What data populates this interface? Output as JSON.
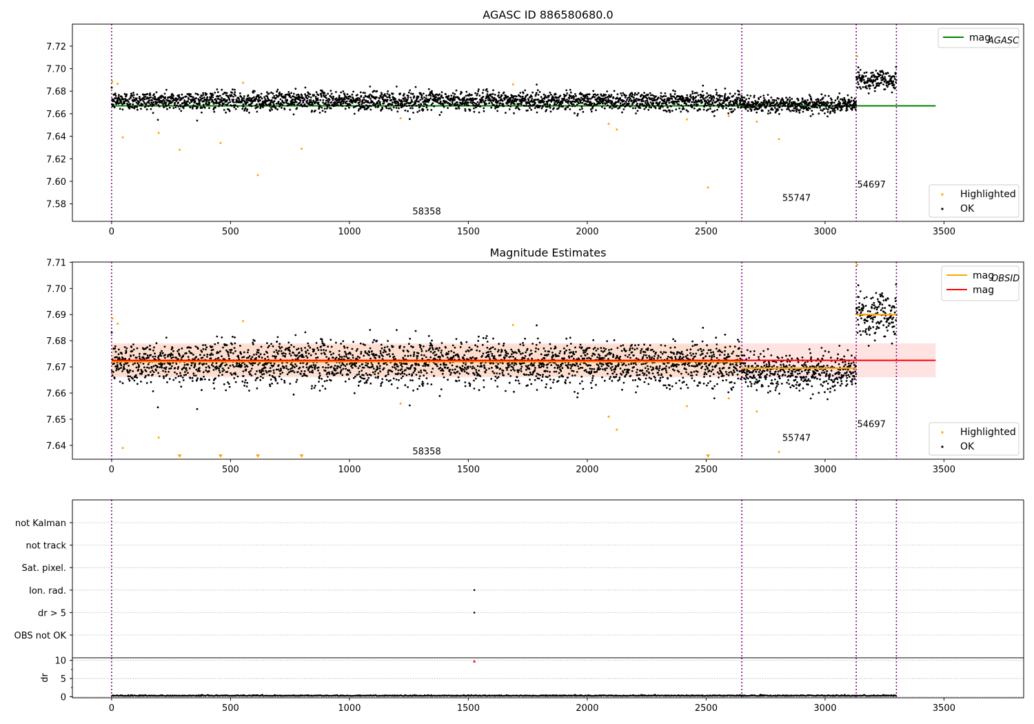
{
  "colors": {
    "ok": "#000000",
    "highlighted": "#ffa500",
    "agasc_line": "#008000",
    "obsid_line": "#ffa500",
    "mag_line": "#ff0000",
    "band_outer": "#ffe0e0",
    "band_inner": "#fddcc8",
    "obs_boundary": "#800080",
    "grid": "#b0b0b0",
    "dr_marker": "#ff0000"
  },
  "chart_data": [
    {
      "id": "top",
      "type": "scatter",
      "title": "AGASC ID 886580680.0",
      "xlim": [
        -165,
        3835
      ],
      "ylim": [
        7.5645,
        7.7395
      ],
      "x_ticks": [
        0,
        500,
        1000,
        1500,
        2000,
        2500,
        3000,
        3500
      ],
      "y_ticks": [
        7.58,
        7.6,
        7.62,
        7.64,
        7.66,
        7.68,
        7.7,
        7.72
      ],
      "y_tick_labels": [
        "7.58",
        "7.60",
        "7.62",
        "7.64",
        "7.66",
        "7.68",
        "7.70",
        "7.72"
      ],
      "hlines": [
        {
          "name": "mag_AGASC",
          "y": 7.667,
          "x": [
            0,
            3465
          ],
          "color": "#008000"
        }
      ],
      "obs_boundaries": [
        0,
        2650,
        3131,
        3300
      ],
      "obs_labels": [
        {
          "text": "58358",
          "x": 1325,
          "y": 7.5705
        },
        {
          "text": "55747",
          "x": 2880,
          "y": 7.5825
        },
        {
          "text": "54697",
          "x": 3195,
          "y": 7.5945
        }
      ],
      "ok_segments": [
        {
          "x": [
            0,
            2650
          ],
          "mean": 7.6715,
          "sd": 0.0042
        },
        {
          "x": [
            2650,
            3131
          ],
          "mean": 7.668,
          "sd": 0.0035
        },
        {
          "x": [
            3131,
            3300
          ],
          "mean": 7.69,
          "sd": 0.0045
        }
      ],
      "ok_count": 3300,
      "highlighted_points": [
        [
          3,
          7.6885
        ],
        [
          25,
          7.6865
        ],
        [
          47,
          7.639
        ],
        [
          198,
          7.643
        ],
        [
          286,
          7.628
        ],
        [
          458,
          7.634
        ],
        [
          553,
          7.6875
        ],
        [
          615,
          7.6055
        ],
        [
          799,
          7.629
        ],
        [
          1215,
          7.656
        ],
        [
          1688,
          7.686
        ],
        [
          2090,
          7.651
        ],
        [
          2124,
          7.646
        ],
        [
          2419,
          7.655
        ],
        [
          2508,
          7.5945
        ],
        [
          2595,
          7.658
        ],
        [
          2713,
          7.653
        ],
        [
          2806,
          7.6375
        ],
        [
          3135,
          7.711
        ]
      ],
      "legend_upper": [
        {
          "label": "mag",
          "sub": "AGASC",
          "kind": "line",
          "color": "#008000"
        }
      ],
      "legend_lower": [
        {
          "label": "Highlighted",
          "kind": "marker",
          "color": "#ffa500"
        },
        {
          "label": "OK",
          "kind": "marker",
          "color": "#000000"
        }
      ]
    },
    {
      "id": "middle",
      "type": "scatter",
      "title": "Magnitude Estimates",
      "xlim": [
        -165,
        3835
      ],
      "ylim": [
        7.6347,
        7.7101
      ],
      "x_ticks": [
        0,
        500,
        1000,
        1500,
        2000,
        2500,
        3000,
        3500
      ],
      "y_ticks": [
        7.64,
        7.65,
        7.66,
        7.67,
        7.68,
        7.69,
        7.7,
        7.71
      ],
      "y_tick_labels": [
        "7.64",
        "7.65",
        "7.66",
        "7.67",
        "7.68",
        "7.69",
        "7.70",
        "7.71"
      ],
      "mag": {
        "y": 7.6725,
        "x": [
          0,
          3465
        ],
        "band_outer": [
          7.666,
          7.679
        ],
        "band_inner": [
          7.6665,
          7.6785
        ],
        "color": "#ff0000"
      },
      "obsid_lines": [
        {
          "x": [
            0,
            2650
          ],
          "y": 7.672
        },
        {
          "x": [
            2650,
            3131
          ],
          "y": 7.6695
        },
        {
          "x": [
            3131,
            3300
          ],
          "y": 7.69
        }
      ],
      "obs_boundaries": [
        0,
        2650,
        3131,
        3300
      ],
      "obs_labels": [
        {
          "text": "58358",
          "x": 1325,
          "y": 7.6365
        },
        {
          "text": "55747",
          "x": 2880,
          "y": 7.6417
        },
        {
          "text": "54697",
          "x": 3195,
          "y": 7.647
        }
      ],
      "ok_segments": [
        {
          "x": [
            0,
            2650
          ],
          "mean": 7.6715,
          "sd": 0.0042
        },
        {
          "x": [
            2650,
            3131
          ],
          "mean": 7.668,
          "sd": 0.0035
        },
        {
          "x": [
            3131,
            3300
          ],
          "mean": 7.69,
          "sd": 0.0045
        }
      ],
      "ok_count": 3300,
      "highlighted_points": [
        [
          3,
          7.6885
        ],
        [
          25,
          7.6865
        ],
        [
          47,
          7.639
        ],
        [
          198,
          7.643
        ],
        [
          553,
          7.6875
        ],
        [
          1215,
          7.656
        ],
        [
          1688,
          7.686
        ],
        [
          2090,
          7.651
        ],
        [
          2124,
          7.646
        ],
        [
          2419,
          7.655
        ],
        [
          2595,
          7.658
        ],
        [
          2713,
          7.653
        ],
        [
          2806,
          7.6375
        ],
        [
          3135,
          7.709
        ]
      ],
      "below_range_markers": [
        286,
        458,
        615,
        799,
        2508
      ],
      "legend_upper": [
        {
          "label": "mag",
          "sub": "OBSID",
          "kind": "line",
          "color": "#ffa500"
        },
        {
          "label": "mag",
          "sub": "",
          "kind": "line",
          "color": "#ff0000"
        }
      ],
      "legend_lower": [
        {
          "label": "Highlighted",
          "kind": "marker",
          "color": "#ffa500"
        },
        {
          "label": "OK",
          "kind": "marker",
          "color": "#000000"
        }
      ]
    },
    {
      "id": "flags",
      "type": "scatter",
      "xlim": [
        -165,
        3835
      ],
      "categories": [
        "OBS not OK",
        "dr > 5",
        "Ion. rad.",
        "Sat. pixel.",
        "not track",
        "not Kalman"
      ],
      "flag_points": [
        {
          "category": "dr > 5",
          "x": [
            1525
          ]
        },
        {
          "category": "Ion. rad.",
          "x": [
            1525
          ]
        }
      ],
      "obs_boundaries": [
        0,
        2650,
        3131,
        3300
      ],
      "grid": true
    },
    {
      "id": "dr",
      "type": "scatter",
      "ylabel": "dr",
      "xlim": [
        -165,
        3835
      ],
      "ylim": [
        -0.3,
        10.7
      ],
      "x_ticks": [
        0,
        500,
        1000,
        1500,
        2000,
        2500,
        3000,
        3500
      ],
      "y_ticks": [
        0,
        5,
        10
      ],
      "y_tick_labels": [
        "0",
        "5",
        "10"
      ],
      "baseline": 0.2,
      "ok_count": 3300,
      "threshold_markers": [
        {
          "x": 1525,
          "y": 9.8
        }
      ],
      "obs_boundaries": [
        0,
        2650,
        3131,
        3300
      ],
      "grid": true
    }
  ]
}
